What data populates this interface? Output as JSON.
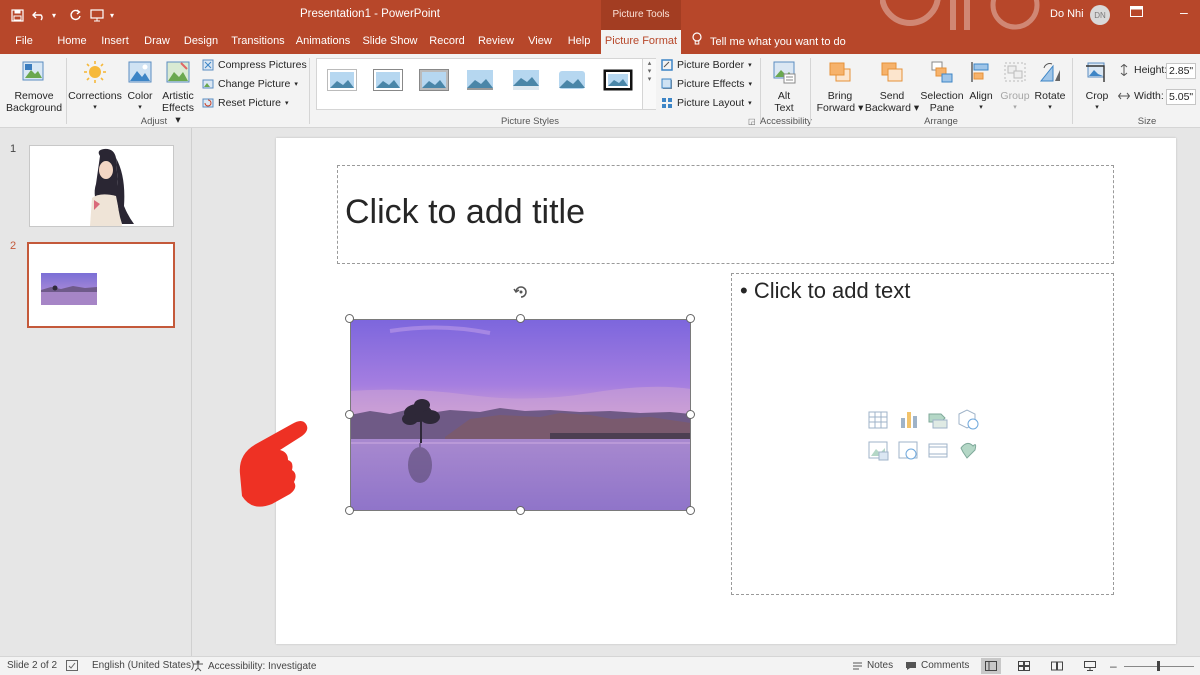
{
  "window": {
    "document_title": "Presentation1  -  PowerPoint",
    "context_group": "Picture Tools",
    "user_name": "Do Nhi",
    "user_initials": "DN"
  },
  "tabs": [
    {
      "label": "File"
    },
    {
      "label": "Home"
    },
    {
      "label": "Insert"
    },
    {
      "label": "Draw"
    },
    {
      "label": "Design"
    },
    {
      "label": "Transitions"
    },
    {
      "label": "Animations"
    },
    {
      "label": "Slide Show"
    },
    {
      "label": "Record"
    },
    {
      "label": "Review"
    },
    {
      "label": "View"
    },
    {
      "label": "Help"
    },
    {
      "label": "Picture Format"
    }
  ],
  "tell_me": "Tell me what you want to do",
  "ribbon": {
    "remove_background_1": "Remove",
    "remove_background_2": "Background",
    "corrections": "Corrections",
    "color": "Color",
    "artistic_1": "Artistic",
    "artistic_2": "Effects",
    "compress": "Compress Pictures",
    "change_picture": "Change Picture",
    "reset_picture": "Reset Picture",
    "group_adjust": "Adjust",
    "picture_border": "Picture Border",
    "picture_effects": "Picture Effects",
    "picture_layout": "Picture Layout",
    "group_styles": "Picture Styles",
    "alt_text_1": "Alt",
    "alt_text_2": "Text",
    "group_accessibility": "Accessibility",
    "bring_forward_1": "Bring",
    "bring_forward_2": "Forward",
    "send_backward_1": "Send",
    "send_backward_2": "Backward",
    "selection_pane_1": "Selection",
    "selection_pane_2": "Pane",
    "align": "Align",
    "group_btn": "Group",
    "rotate": "Rotate",
    "group_arrange": "Arrange",
    "crop": "Crop",
    "height_label": "Height:",
    "height_value": "2.85\"",
    "width_label": "Width:",
    "width_value": "5.05\"",
    "group_size": "Size"
  },
  "thumbnails": [
    {
      "number": "1"
    },
    {
      "number": "2"
    }
  ],
  "slide": {
    "title_placeholder": "Click to add title",
    "content_placeholder": "• Click to add text"
  },
  "status": {
    "slide_info": "Slide 2 of 2",
    "language": "English (United States)",
    "accessibility": "Accessibility: Investigate",
    "notes": "Notes",
    "comments": "Comments"
  },
  "colors": {
    "accent": "#b7472a",
    "selected_thumb_border": "#c4593a"
  }
}
